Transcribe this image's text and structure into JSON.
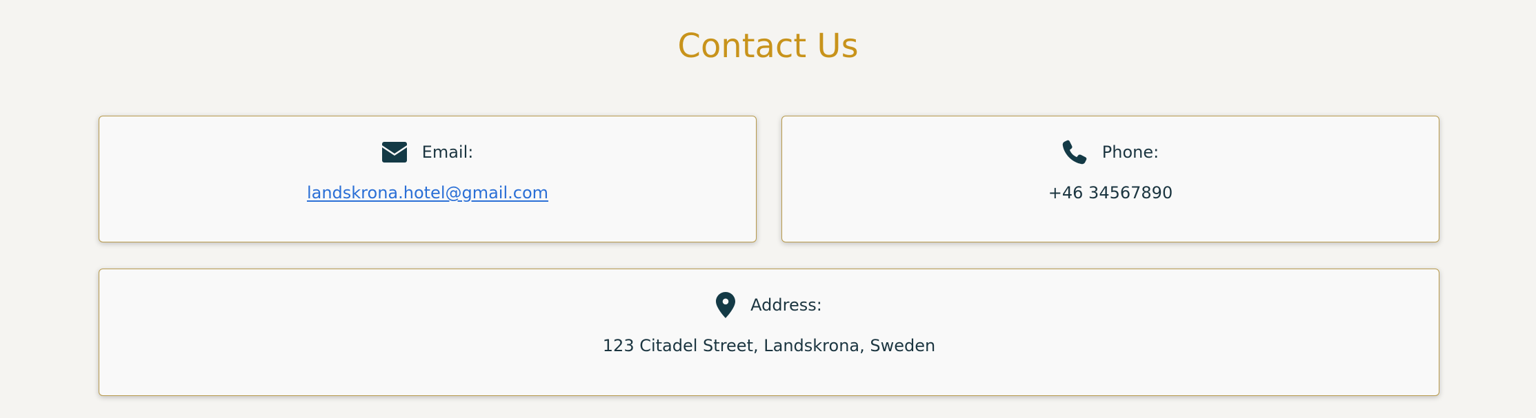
{
  "section": {
    "title": "Contact Us"
  },
  "contact": {
    "email": {
      "icon": "envelope-icon",
      "label": "Email:",
      "value": "landskrona.hotel@gmail.com"
    },
    "phone": {
      "icon": "phone-icon",
      "label": "Phone:",
      "value": "+46 34567890"
    },
    "address": {
      "icon": "map-pin-icon",
      "label": "Address:",
      "value": "123 Citadel Street, Landskrona, Sweden"
    }
  },
  "colors": {
    "background": "#f5f4f1",
    "title": "#c8931b",
    "card_border": "#b89a4c",
    "icon": "#143a46",
    "link": "#2a6fd6"
  }
}
